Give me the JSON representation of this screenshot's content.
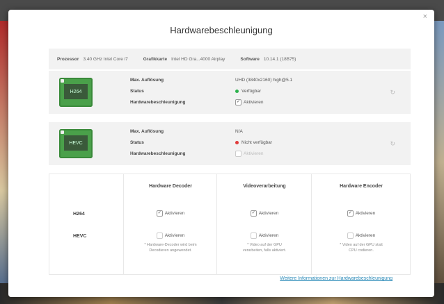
{
  "dialog": {
    "title": "Hardwarebeschleunigung",
    "close": "×"
  },
  "info": {
    "processor_label": "Prozessor",
    "processor_value": "3.40 GHz Intel Core i7",
    "graphics_label": "Grafikkarte",
    "graphics_value": "Intel HD Gra...4000 Airplay",
    "software_label": "Software",
    "software_value": "10.14.1 (18B75)"
  },
  "cards": [
    {
      "chip_label": "H264",
      "res_label": "Max. Auflösung",
      "res_value": "UHD (3840x2160) high@5.1",
      "status_label": "Status",
      "status_value": "Verfügbar",
      "status_color": "#2bb24c",
      "hw_label": "Hardwarebeschleunigung",
      "hw_value": "Aktivieren",
      "hw_checked": "✓"
    },
    {
      "chip_label": "HEVC",
      "res_label": "Max. Auflösung",
      "res_value": "N/A",
      "status_label": "Status",
      "status_value": "Nicht verfügbar",
      "status_color": "#e03a3a",
      "hw_label": "Hardwarebeschleunigung",
      "hw_value": "Aktivieren",
      "hw_checked": ""
    }
  ],
  "refresh_icon": "↻",
  "table": {
    "rows": [
      "H264",
      "HEVC"
    ],
    "columns": [
      {
        "header": "Hardware Decoder",
        "h264": "Aktivieren",
        "hevc": "Aktivieren",
        "note_1": "* Hardware-Decoder wird beim",
        "note_2": "Decodieren angewendet."
      },
      {
        "header": "Videoverarbeitung",
        "h264": "Aktivieren",
        "hevc": "Aktivieren",
        "note_1": "* Video auf der GPU",
        "note_2": "verarbeiten, falls aktiviert."
      },
      {
        "header": "Hardware Encoder",
        "h264": "Aktivieren",
        "hevc": "Aktivieren",
        "note_1": "* Video auf der GPU statt",
        "note_2": "CPU codieren."
      }
    ],
    "check": "✓"
  },
  "link": "Weitere Informationen zur Hardwarebeschleunigung"
}
